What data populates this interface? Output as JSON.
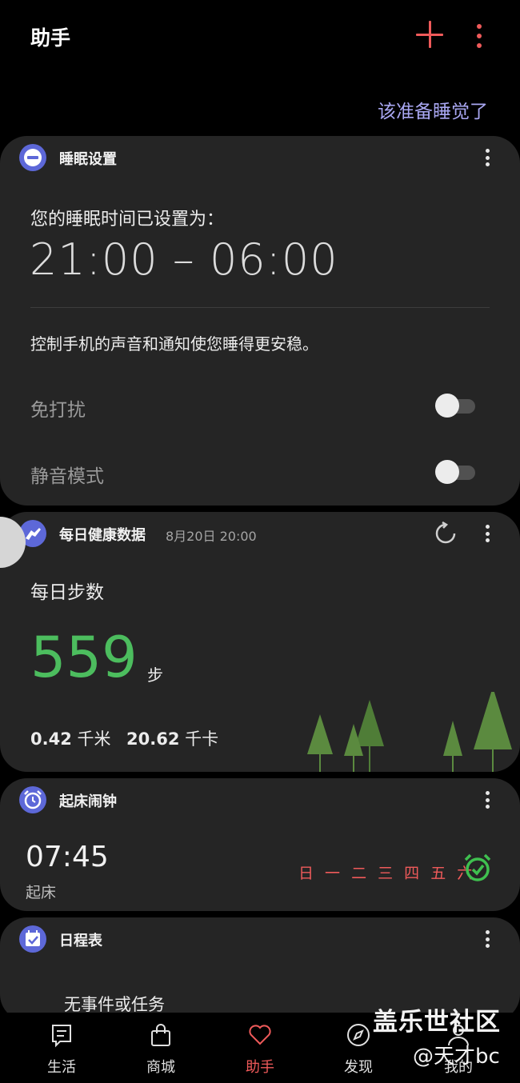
{
  "header": {
    "title": "助手"
  },
  "hint_text": "该准备睡觉了",
  "sleep_card": {
    "title": "睡眠设置",
    "label": "您的睡眠时间已设置为：",
    "time_range": "21:00 – 06:00",
    "description": "控制手机的声音和通知使您睡得更安稳。",
    "toggles": [
      {
        "label": "免打扰",
        "on": false
      },
      {
        "label": "静音模式",
        "on": false
      }
    ]
  },
  "health_card": {
    "title": "每日健康数据",
    "date": "8月20日 20:00",
    "steps_label": "每日步数",
    "steps": "559",
    "steps_unit": "步",
    "distance_value": "0.42",
    "distance_unit": "千米",
    "calories_value": "20.62",
    "calories_unit": "千卡"
  },
  "alarm_card": {
    "title": "起床闹钟",
    "time": "07:45",
    "label": "起床",
    "days": "日 一 二 三 四 五 六",
    "day_color": "#ef5a5a",
    "enabled": true
  },
  "schedule_card": {
    "title": "日程表",
    "empty_text": "无事件或任务"
  },
  "bottom_nav": {
    "items": [
      {
        "label": "生活",
        "icon": "note-icon"
      },
      {
        "label": "商城",
        "icon": "shopping-bag-icon"
      },
      {
        "label": "助手",
        "icon": "heart-icon",
        "active": true
      },
      {
        "label": "发现",
        "icon": "compass-icon"
      },
      {
        "label": "我的",
        "icon": "person-icon"
      }
    ]
  },
  "watermark": {
    "line1": "盖乐世社区",
    "line2": "@天才bc"
  },
  "colors": {
    "accent": "#ef5a5a",
    "steps_green": "#4cbd5e",
    "hint_purple": "#a9a7f2",
    "card_icon": "#5d68d8"
  }
}
